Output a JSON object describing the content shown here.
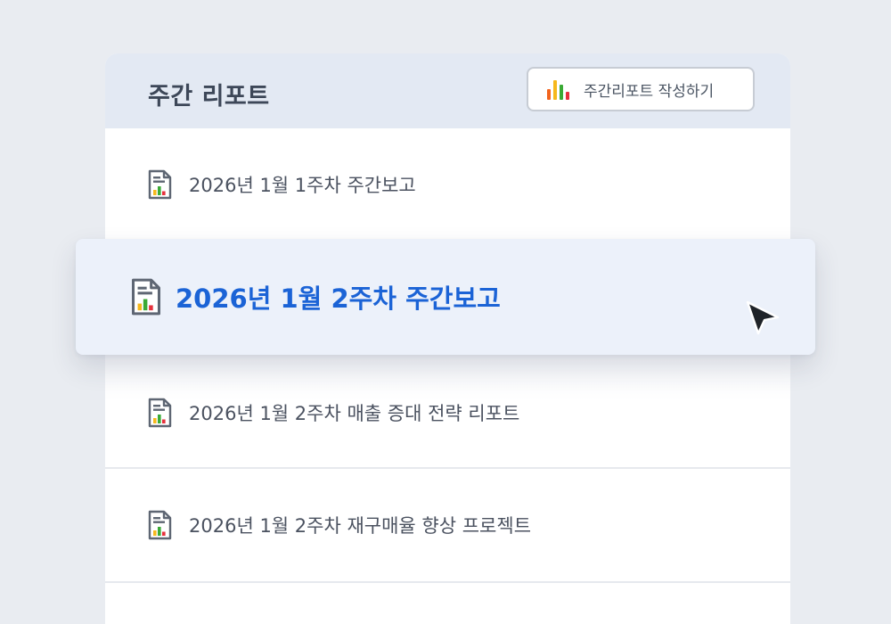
{
  "header": {
    "title": "주간 리포트",
    "create_button": {
      "label": "주간리포트 작성하기",
      "icon": "bar-chart-icon"
    }
  },
  "reports": [
    {
      "label": "2026년 1월 1주차 주간보고",
      "icon": "report-document-icon"
    },
    {
      "label": "2026년 1월 2주차 주간보고",
      "icon": "report-document-icon",
      "highlighted": true
    },
    {
      "label": "2026년 1월 2주차 매출 증대 전략 리포트",
      "icon": "report-document-icon"
    },
    {
      "label": "2026년 1월 2주차 재구매율 향상 프로젝트",
      "icon": "report-document-icon"
    }
  ],
  "colors": {
    "background": "#e9ecf1",
    "header_background": "#e3e9f3",
    "highlight_background": "#ecf1fa",
    "highlight_text": "#1b63d6",
    "bar_orange": "#f2641e",
    "bar_yellow": "#f6b81c",
    "bar_green": "#3aaa35",
    "bar_red": "#e6313c"
  },
  "cursor": "mouse-pointer-icon"
}
